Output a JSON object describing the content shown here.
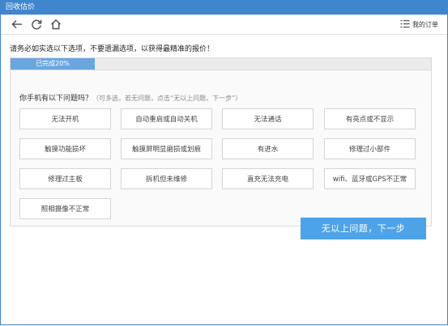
{
  "window": {
    "title": "回收估价"
  },
  "toolbar": {
    "orders_label": "我的订单"
  },
  "notice": "请务必如实选以下选项，不要遗漏选项，以获得最精准的报价！",
  "progress": {
    "label": "已完成20%",
    "percent": 20
  },
  "question": {
    "text": "你手机有以下问题吗？",
    "hint": "（可多选，若无问题，点击“无以上问题，下一步”）"
  },
  "options": [
    "无法开机",
    "自动重启或自动关机",
    "无法通话",
    "有亮点或不显示",
    "触摸功能损坏",
    "触摸屏明显磨损或划痕",
    "有进水",
    "修理过小部件",
    "修理过主板",
    "拆机但未维修",
    "直充无法充电",
    "wifi、蓝牙或GPS不正常",
    "照相摄像不正常"
  ],
  "next_button": "无以上问题，下一步",
  "colors": {
    "titlebar": "#3f86cc",
    "progress_fill": "#6aa7e0",
    "primary_button": "#4ea3e8"
  }
}
